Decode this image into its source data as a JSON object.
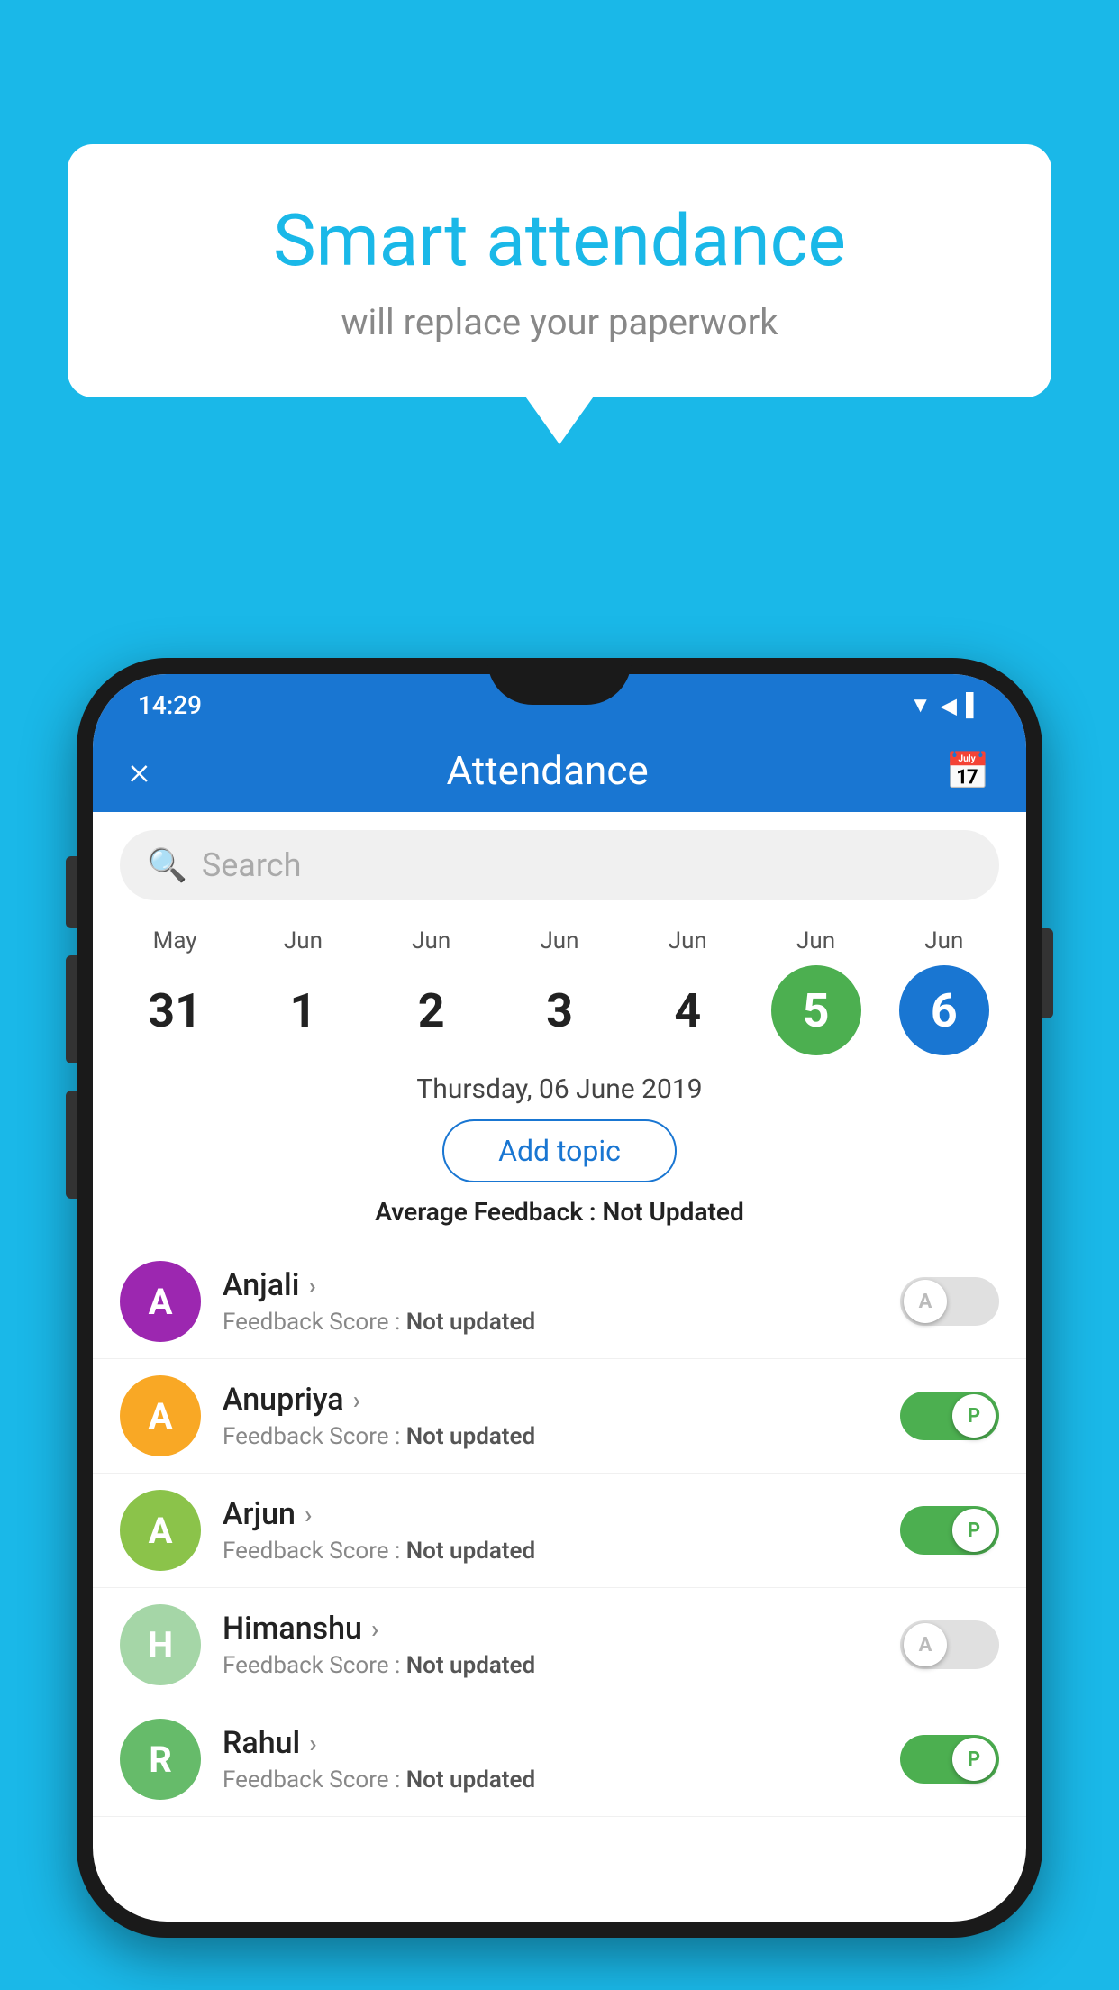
{
  "background_color": "#1ab8e8",
  "bubble": {
    "title": "Smart attendance",
    "subtitle": "will replace your paperwork"
  },
  "status_bar": {
    "time": "14:29",
    "icons": [
      "wifi",
      "signal",
      "battery"
    ]
  },
  "header": {
    "close_label": "×",
    "title": "Attendance",
    "calendar_icon": "📅"
  },
  "search": {
    "placeholder": "Search"
  },
  "calendar": {
    "days": [
      {
        "month": "May",
        "date": "31",
        "highlight": ""
      },
      {
        "month": "Jun",
        "date": "1",
        "highlight": ""
      },
      {
        "month": "Jun",
        "date": "2",
        "highlight": ""
      },
      {
        "month": "Jun",
        "date": "3",
        "highlight": ""
      },
      {
        "month": "Jun",
        "date": "4",
        "highlight": ""
      },
      {
        "month": "Jun",
        "date": "5",
        "highlight": "green"
      },
      {
        "month": "Jun",
        "date": "6",
        "highlight": "blue"
      }
    ]
  },
  "selected_date": "Thursday, 06 June 2019",
  "add_topic_label": "Add topic",
  "avg_feedback_label": "Average Feedback :",
  "avg_feedback_value": "Not Updated",
  "students": [
    {
      "name": "Anjali",
      "initial": "A",
      "avatar_color": "#9c27b0",
      "score_label": "Feedback Score :",
      "score_value": "Not updated",
      "toggle": "off",
      "toggle_label": "A"
    },
    {
      "name": "Anupriya",
      "initial": "A",
      "avatar_color": "#f9a825",
      "score_label": "Feedback Score :",
      "score_value": "Not updated",
      "toggle": "on",
      "toggle_label": "P"
    },
    {
      "name": "Arjun",
      "initial": "A",
      "avatar_color": "#8bc34a",
      "score_label": "Feedback Score :",
      "score_value": "Not updated",
      "toggle": "on",
      "toggle_label": "P"
    },
    {
      "name": "Himanshu",
      "initial": "H",
      "avatar_color": "#a5d6a7",
      "score_label": "Feedback Score :",
      "score_value": "Not updated",
      "toggle": "off",
      "toggle_label": "A"
    },
    {
      "name": "Rahul",
      "initial": "R",
      "avatar_color": "#66bb6a",
      "score_label": "Feedback Score :",
      "score_value": "Not updated",
      "toggle": "on",
      "toggle_label": "P"
    }
  ]
}
